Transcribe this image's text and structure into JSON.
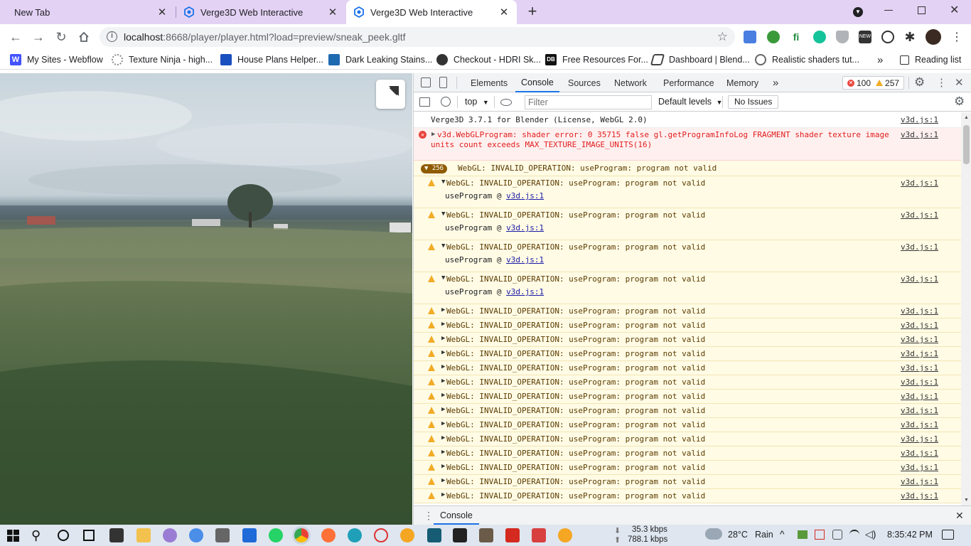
{
  "tabs": [
    {
      "title": "New Tab"
    },
    {
      "title": "Verge3D Web Interactive"
    },
    {
      "title": "Verge3D Web Interactive"
    }
  ],
  "toolbar": {
    "url_host": "localhost",
    "url_rest": ":8668/player/player.html?load=preview/sneak_peek.gltf"
  },
  "bookmarks": [
    {
      "label": "My Sites - Webflow",
      "icon": "webflow-icon",
      "color": "#4353ff"
    },
    {
      "label": "Texture Ninja - high...",
      "icon": "ninja-icon",
      "color": "#888888"
    },
    {
      "label": "House Plans Helper...",
      "icon": "house-icon",
      "color": "#1a4fbf"
    },
    {
      "label": "Dark Leaking Stains...",
      "icon": "cube-icon",
      "color": "#1e6ab0"
    },
    {
      "label": "Checkout - HDRI Sk...",
      "icon": "hdri-icon",
      "color": "#333333"
    },
    {
      "label": "Free Resources For...",
      "icon": "db-icon",
      "color": "#111111"
    },
    {
      "label": "Dashboard | Blend...",
      "icon": "blend-icon",
      "color": "#444444"
    },
    {
      "label": "Realistic shaders tut...",
      "icon": "globe-icon",
      "color": "#666666"
    }
  ],
  "reading_list": "Reading list",
  "devtools": {
    "tabs": [
      "Elements",
      "Console",
      "Sources",
      "Network",
      "Performance",
      "Memory"
    ],
    "error_count": "100",
    "warning_count": "257",
    "context": "top",
    "filter_placeholder": "Filter",
    "levels": "Default levels",
    "issues": "No Issues",
    "drawer_tab": "Console"
  },
  "console": {
    "info": {
      "msg": "Verge3D 3.7.1 for Blender (License, WebGL 2.0)",
      "src": "v3d.js:1"
    },
    "error": {
      "line1": "v3d.WebGLProgram: shader error:  0 35715 false gl.getProgramInfoLog FRAGMENT shader texture image",
      "line2": "units count exceeds MAX_TEXTURE_IMAGE_UNITS(16)",
      "src": "v3d.js:1"
    },
    "group": {
      "count": "256",
      "msg": "WebGL: INVALID_OPERATION: useProgram: program not valid"
    },
    "warn_msg": "WebGL: INVALID_OPERATION: useProgram: program not valid",
    "warn_src": "v3d.js:1",
    "sub_prefix": "useProgram @ ",
    "sub_link": "v3d.js:1"
  },
  "taskbar": {
    "net_down": "35.3 kbps",
    "net_up": "788.1 kbps",
    "temperature": "28°C",
    "weather": "Rain",
    "time": "8:35:42 PM"
  }
}
